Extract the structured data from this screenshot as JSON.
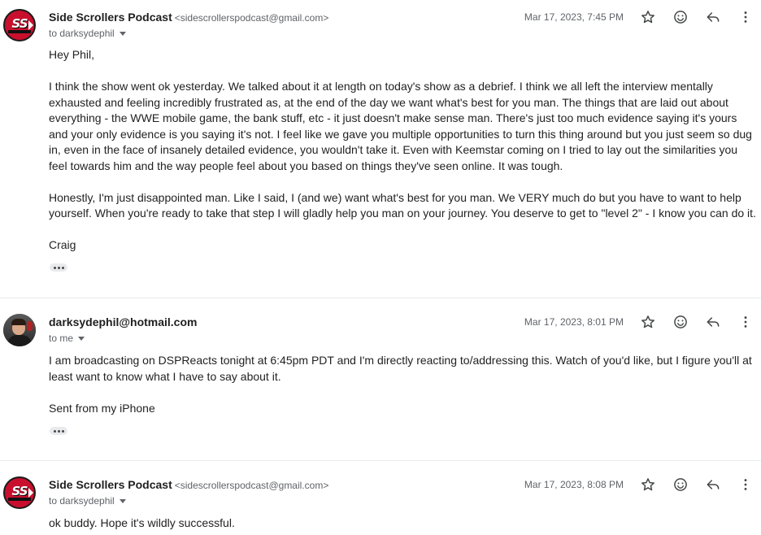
{
  "messages": [
    {
      "sender_name": "Side Scrollers Podcast",
      "sender_email": "<sidescrollerspodcast@gmail.com>",
      "avatar_text": "SS",
      "to_line": "to darksydephil",
      "date": "Mar 17, 2023, 7:45 PM",
      "body": [
        "Hey Phil,",
        "",
        "I think the show went ok yesterday. We talked about it at length on today's show as a debrief. I think we all left the interview mentally exhausted and feeling incredibly frustrated as, at the end of the day we want what's best for you man. The things that are laid out about everything - the WWE mobile game, the bank stuff, etc - it just doesn't make sense man. There's just too much evidence saying it's yours and your only evidence is you saying it's not. I feel like we gave you multiple opportunities to turn this thing around but you just seem so dug in, even in the face of insanely detailed evidence, you wouldn't take it. Even with Keemstar coming on I tried to lay out the similarities you feel towards him and the way people feel about you based on things they've seen online. It was tough.",
        "",
        "Honestly, I'm just disappointed man. Like I said, I (and we) want what's best for you man. We VERY much do but you have to want to help yourself. When you're ready to take that step I will gladly help you man on your journey. You deserve to get to \"level 2\" - I know you can do it.",
        "",
        "Craig"
      ]
    },
    {
      "sender_name": "darksydephil@hotmail.com",
      "sender_email": "",
      "to_line": "to me",
      "date": "Mar 17, 2023, 8:01 PM",
      "body": [
        "I am broadcasting on DSPReacts tonight at 6:45pm PDT and I'm directly reacting to/addressing this. Watch of you'd like, but I figure you'll at least want to know what I have to say about it.",
        "",
        "Sent from my iPhone"
      ]
    },
    {
      "sender_name": "Side Scrollers Podcast",
      "sender_email": "<sidescrollerspodcast@gmail.com>",
      "avatar_text": "SS",
      "to_line": "to darksydephil",
      "date": "Mar 17, 2023, 8:08 PM",
      "body": [
        "ok buddy. Hope it's wildly successful."
      ]
    }
  ],
  "icons": [
    "star-icon",
    "emoji-icon",
    "reply-icon",
    "more-vert-icon",
    "chevron-down-icon",
    "ellipsis-icon"
  ],
  "colors": {
    "avatar_red": "#c8102e",
    "text": "#222222",
    "muted": "#5f6368",
    "divider": "#e8eaed"
  }
}
